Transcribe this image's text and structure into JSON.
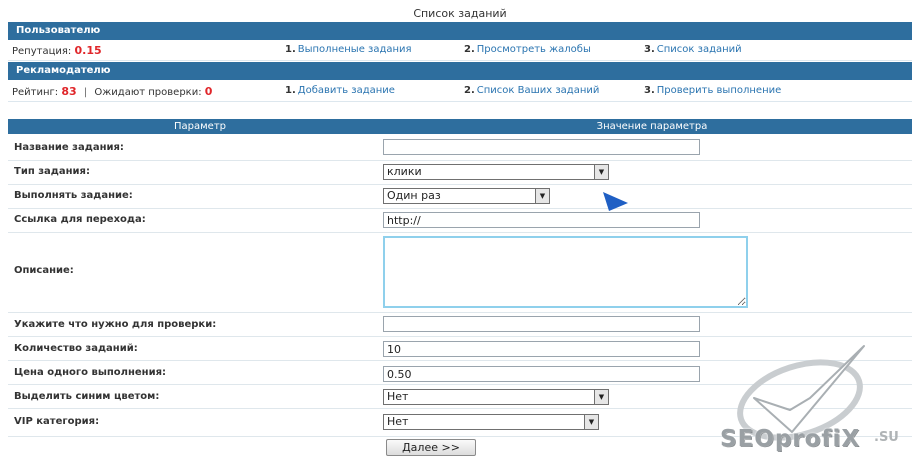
{
  "page_title": "Список заданий",
  "user_section": {
    "title": "Пользователю",
    "reputation_label": "Репутация:",
    "reputation_value": "0.15",
    "links": [
      {
        "num": "1.",
        "label": "Выполненые задания"
      },
      {
        "num": "2.",
        "label": "Просмотреть жалобы"
      },
      {
        "num": "3.",
        "label": "Список заданий"
      }
    ]
  },
  "advertiser_section": {
    "title": "Рекламодателю",
    "rating_label": "Рейтинг:",
    "rating_value": "83",
    "separator": "|",
    "pending_label": "Ожидают проверки:",
    "pending_value": "0",
    "links": [
      {
        "num": "1.",
        "label": "Добавить задание"
      },
      {
        "num": "2.",
        "label": "Список Ваших заданий"
      },
      {
        "num": "3.",
        "label": "Проверить выполнение"
      }
    ]
  },
  "form": {
    "header_param": "Параметр",
    "header_value": "Значение параметра",
    "task_name_label": "Название задания:",
    "task_name_value": "",
    "task_type_label": "Тип задания:",
    "task_type_value": "клики",
    "execute_label": "Выполнять задание:",
    "execute_value": "Один раз",
    "link_label": "Ссылка для перехода:",
    "link_value": "http://",
    "description_label": "Описание:",
    "check_label": "Укажите что нужно для проверки:",
    "check_value": "",
    "count_label": "Количество заданий:",
    "count_value": "10",
    "price_label": "Цена одного выполнения:",
    "price_value": "0.50",
    "highlight_label": "Выделить синим цветом:",
    "highlight_value": "Нет",
    "vip_label": "VIP категория:",
    "vip_value": "Нет",
    "submit_label": "Далее >>"
  },
  "watermark": {
    "text": "SEOprofiX",
    "suffix": ".SU"
  },
  "colors": {
    "header_blue": "#2e6e9e",
    "link_blue": "#2a74b0",
    "value_red": "#e0262a",
    "cursor_blue": "#1f5fc4"
  }
}
